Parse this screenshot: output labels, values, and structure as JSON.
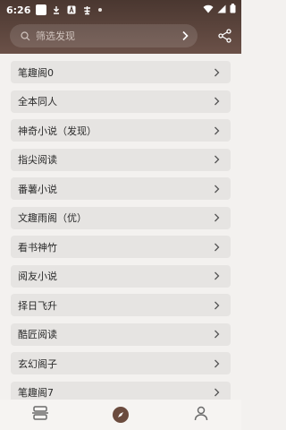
{
  "status_bar": {
    "time": "6:26",
    "icons": [
      "notification-box-icon",
      "download-icon",
      "a-icon",
      "app-icon",
      "dot-icon"
    ],
    "right_icons": [
      "wifi-icon",
      "signal-icon",
      "battery-icon"
    ]
  },
  "search": {
    "placeholder": "筛选发现",
    "icon": "search-icon",
    "go_icon": "chevron-right-icon",
    "share_icon": "share-nodes-icon"
  },
  "sources": [
    {
      "label": "笔趣阁0"
    },
    {
      "label": "全本同人"
    },
    {
      "label": "神奇小说（发现）"
    },
    {
      "label": "指尖阅读"
    },
    {
      "label": "番薯小说"
    },
    {
      "label": "文趣雨阁（优）"
    },
    {
      "label": "看书神竹"
    },
    {
      "label": "阅友小说"
    },
    {
      "label": "择日飞升"
    },
    {
      "label": "酷匠阅读"
    },
    {
      "label": "玄幻阁子"
    },
    {
      "label": "笔趣阁7"
    }
  ],
  "bottom_nav": {
    "items": [
      {
        "name": "bookshelf-icon",
        "active": false
      },
      {
        "name": "discover-icon",
        "active": true
      },
      {
        "name": "profile-icon",
        "active": false
      }
    ]
  },
  "colors": {
    "header_bg": "#5a4138",
    "accent": "#6b4b3e",
    "item_bg": "#e6e4e2",
    "page_bg": "#f3f1ef"
  }
}
